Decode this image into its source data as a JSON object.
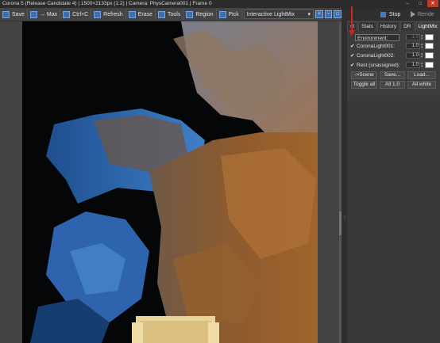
{
  "window": {
    "title": "Corona 5 (Release Candidate 4) | 1500×2133px (1:2) | Camera: PhysCamera001 | Frame 0",
    "controls": [
      "–",
      "□",
      "✕"
    ]
  },
  "toolbar": {
    "save": "Save",
    "max": "→ Max",
    "ctrl_c": "Ctrl+C",
    "refresh": "Refresh",
    "erase": "Erase",
    "tools": "Tools",
    "region": "Region",
    "pick": "Pick",
    "mode": "Interactive LightMix"
  },
  "render_panel": {
    "stop": "Stop",
    "render": "Rende"
  },
  "tabs": [
    {
      "label": "st"
    },
    {
      "label": "Stats"
    },
    {
      "label": "History"
    },
    {
      "label": "DR"
    },
    {
      "label": "LightMix",
      "active": true
    }
  ],
  "lightmix": {
    "rows": [
      {
        "checked": false,
        "name": "Environment:",
        "value": "1.0",
        "dim": true
      },
      {
        "checked": true,
        "name": "CoronaLight001:",
        "value": "1.0",
        "dim": false
      },
      {
        "checked": true,
        "name": "CoronaLight002:",
        "value": "1.0",
        "dim": false
      },
      {
        "checked": true,
        "name": "Rest (unassigned):",
        "value": "1.0",
        "dim": false
      }
    ],
    "buttons_row1": [
      "->Scene",
      "Save...",
      "Load..."
    ],
    "buttons_row2": [
      "Toggle all",
      "All 1.0",
      "All white"
    ]
  },
  "colors": {
    "accent": "#3c7bd4",
    "annotation_arrow": "#d0241f"
  }
}
